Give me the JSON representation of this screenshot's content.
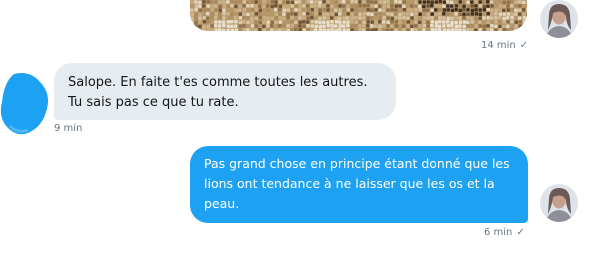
{
  "colors": {
    "incoming_bubble": "#e6ecf0",
    "outgoing_bubble": "#1da1f2",
    "meta_text": "#657786",
    "partner_avatar": "#1da1f2"
  },
  "messages": [
    {
      "direction": "outgoing",
      "type": "image",
      "time": "14 min",
      "status_icon": "check-icon"
    },
    {
      "direction": "incoming",
      "text": "Salope. En faite t'es comme toutes les autres. Tu sais pas ce que tu rate.",
      "time": "9 min"
    },
    {
      "direction": "outgoing",
      "text": "Pas grand chose en principe étant donné que les lions ont tendance à ne laisser que les os et la peau.",
      "time": "6 min",
      "status_icon": "check-icon"
    }
  ],
  "check_glyph": "✓"
}
